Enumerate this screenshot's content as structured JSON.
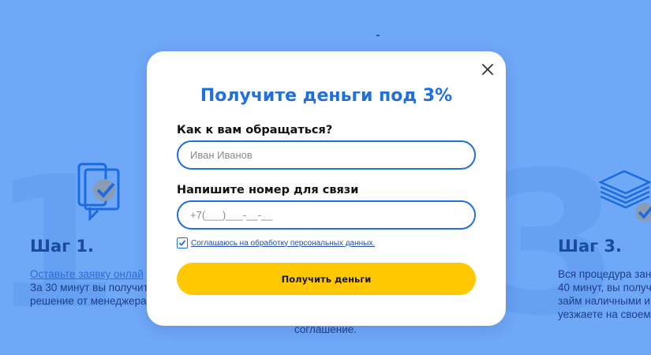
{
  "background": {
    "steps": [
      {
        "title": "Шаг 1.",
        "link": "Оставьте заявку онлай",
        "lines": [
          "За 30 минут вы получит",
          "решение от менеджера"
        ]
      },
      {
        "title": "Шаг 3.",
        "lines": [
          "Вся процедура зан",
          "40 минут, вы получ",
          "займ наличными и",
          "уезжаете на своем"
        ]
      }
    ],
    "middle_text": "соглашение."
  },
  "modal": {
    "title": "Получите деньги под 3%",
    "name_label": "Как к вам обращаться?",
    "name_placeholder": "Иван Иванов",
    "phone_label": "Напишите номер для связи",
    "phone_placeholder": "+7(___)___-__-__",
    "consent_text": "Соглашаюсь на обработку персональных данных.",
    "consent_checked": true,
    "submit_label": "Получить деньги"
  },
  "colors": {
    "page_bg": "#6fa8f7",
    "accent": "#1f6fdd",
    "button": "#ffc800"
  },
  "icons": [
    "document-check-icon",
    "money-stack-icon",
    "close-icon",
    "checkmark-icon"
  ]
}
